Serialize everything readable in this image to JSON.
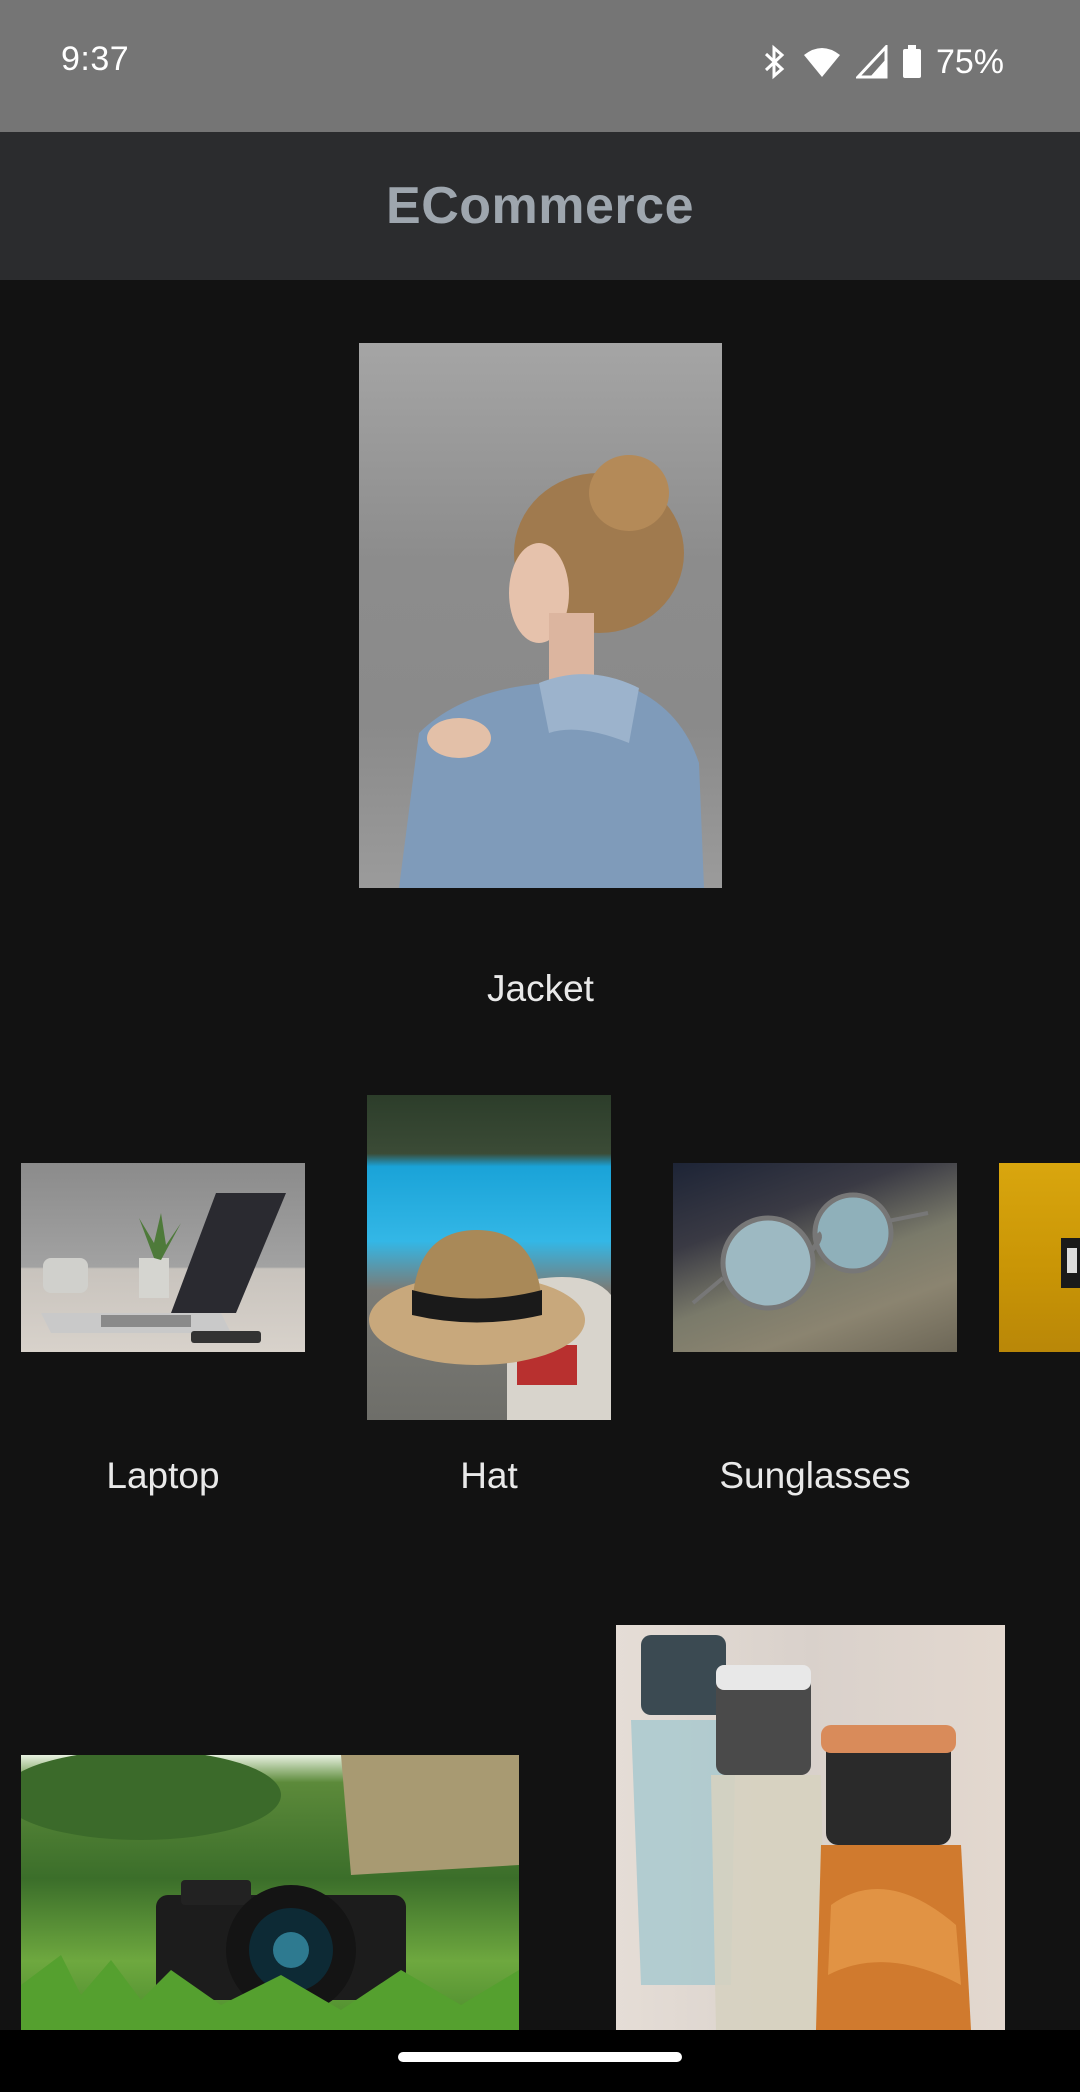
{
  "status_bar": {
    "time": "9:37",
    "battery": "75%",
    "icons": [
      "bluetooth-icon",
      "wifi-icon",
      "cell-signal-icon",
      "battery-icon"
    ]
  },
  "app_bar": {
    "title": "ECommerce"
  },
  "products": {
    "jacket": {
      "label": "Jacket",
      "image": "woman-in-denim-jacket-photo"
    },
    "laptop": {
      "label": "Laptop",
      "image": "laptop-on-desk-photo"
    },
    "hat": {
      "label": "Hat",
      "image": "straw-hat-by-pool-photo"
    },
    "sunglasses": {
      "label": "Sunglasses",
      "image": "round-sunglasses-photo"
    },
    "partial": {
      "image": "yellow-product-photo"
    },
    "camera": {
      "image": "camera-on-grass-photo"
    },
    "perfume": {
      "image": "perfume-bottles-photo"
    }
  },
  "colors": {
    "background": "#121212",
    "status_bar": "#757575",
    "app_bar": "#2b2c2e",
    "title": "#9ea6ae"
  }
}
